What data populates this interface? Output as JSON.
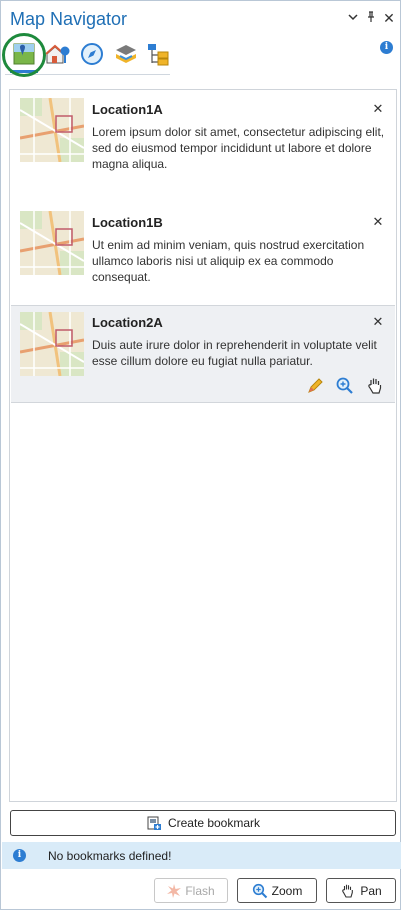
{
  "pane": {
    "title": "Map Navigator",
    "menu_glyph": "⌄",
    "pin_glyph": "ᵖ",
    "close_glyph": "✕",
    "info_glyph": "i"
  },
  "toolbar": {
    "tools": [
      {
        "name": "bookmarks-tool",
        "icon": "map-bookmark-icon",
        "active": true
      },
      {
        "name": "places-tool",
        "icon": "house-pin-icon",
        "active": false
      },
      {
        "name": "navigate-tool",
        "icon": "compass-icon",
        "active": false
      },
      {
        "name": "layers-tool",
        "icon": "map-layers-icon",
        "active": false
      },
      {
        "name": "contents-tool",
        "icon": "tree-view-icon",
        "active": false
      }
    ]
  },
  "bookmarks": [
    {
      "title": "Location1A",
      "description": "Lorem ipsum dolor sit amet, consectetur adipiscing elit, sed do eiusmod tempor incididunt ut labore et dolore magna aliqua.",
      "selected": false
    },
    {
      "title": "Location1B",
      "description": "Ut enim ad minim veniam, quis nostrud exercitation ullamco laboris nisi ut aliquip ex ea commodo consequat.",
      "selected": false
    },
    {
      "title": "Location2A",
      "description": "Duis aute irure dolor in reprehenderit in voluptate velit esse cillum dolore eu fugiat nulla pariatur.",
      "selected": true
    }
  ],
  "item_close_glyph": "✕",
  "create_bookmark_label": "Create bookmark",
  "status": {
    "info_glyph": "i",
    "text": "No bookmarks defined!"
  },
  "buttons": {
    "flash": {
      "label": "Flash",
      "enabled": false
    },
    "zoom": {
      "label": "Zoom",
      "enabled": true
    },
    "pan": {
      "label": "Pan",
      "enabled": true
    }
  },
  "colors": {
    "accent": "#1f6fb5",
    "highlight_ring": "#1e8a3c",
    "status_bg": "#d9ebf8",
    "selected_bg": "#eef0f3"
  }
}
